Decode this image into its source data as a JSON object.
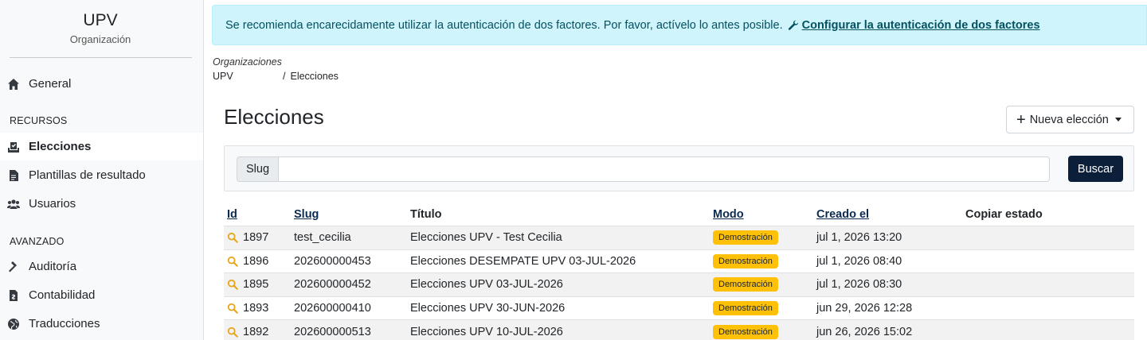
{
  "sidebar": {
    "org_title": "UPV",
    "org_subtitle": "Organización",
    "items": {
      "general": {
        "label": "General",
        "icon": "home-icon"
      },
      "elecciones": {
        "label": "Elecciones",
        "icon": "ballot-box-icon"
      },
      "plantillas": {
        "label": "Plantillas de resultado",
        "icon": "file-icon"
      },
      "usuarios": {
        "label": "Usuarios",
        "icon": "users-icon"
      },
      "auditoria": {
        "label": "Auditoría",
        "icon": "gavel-icon"
      },
      "contabilidad": {
        "label": "Contabilidad",
        "icon": "file-invoice-icon"
      },
      "traducciones": {
        "label": "Traducciones",
        "icon": "globe-icon"
      }
    },
    "section_recursos": "RECURSOS",
    "section_avanzado": "AVANZADO"
  },
  "alert": {
    "text": "Se recomienda encarecidamente utilizar la autenticación de dos factores. Por favor, actívelo lo antes posible.",
    "link": "Configurar la autenticación de dos factores"
  },
  "breadcrumb": {
    "label": "Organizaciones",
    "org": "UPV",
    "separator": "/",
    "current": "Elecciones"
  },
  "header": {
    "title": "Elecciones",
    "new_button": "Nueva elección"
  },
  "search": {
    "label": "Slug",
    "value": "",
    "button": "Buscar"
  },
  "table": {
    "columns": {
      "id": "Id",
      "slug": "Slug",
      "title": "Título",
      "mode": "Modo",
      "created": "Creado el",
      "copy": "Copiar estado"
    },
    "rows": [
      {
        "id": "1897",
        "slug": "test_cecilia",
        "title": "Elecciones UPV - Test Cecilia",
        "mode": "Demostración",
        "created": "jul 1, 2026 13:20",
        "copy": ""
      },
      {
        "id": "1896",
        "slug": "202600000453",
        "title": "Elecciones DESEMPATE UPV 03-JUL-2026",
        "mode": "Demostración",
        "created": "jul 1, 2026 08:40",
        "copy": ""
      },
      {
        "id": "1895",
        "slug": "202600000452",
        "title": "Elecciones UPV 03-JUL-2026",
        "mode": "Demostración",
        "created": "jul 1, 2026 08:30",
        "copy": ""
      },
      {
        "id": "1893",
        "slug": "202600000410",
        "title": "Elecciones UPV 30-JUN-2026",
        "mode": "Demostración",
        "created": "jun 29, 2026 12:28",
        "copy": ""
      },
      {
        "id": "1892",
        "slug": "202600000513",
        "title": "Elecciones UPV 10-JUL-2026",
        "mode": "Demostración",
        "created": "jun 26, 2026 15:02",
        "copy": ""
      }
    ]
  },
  "colors": {
    "alert_bg": "#cff4fc",
    "alert_text": "#055160",
    "primary_dark": "#0b1f3a",
    "badge": "#ffc107",
    "magnifier": "#e8a317"
  }
}
